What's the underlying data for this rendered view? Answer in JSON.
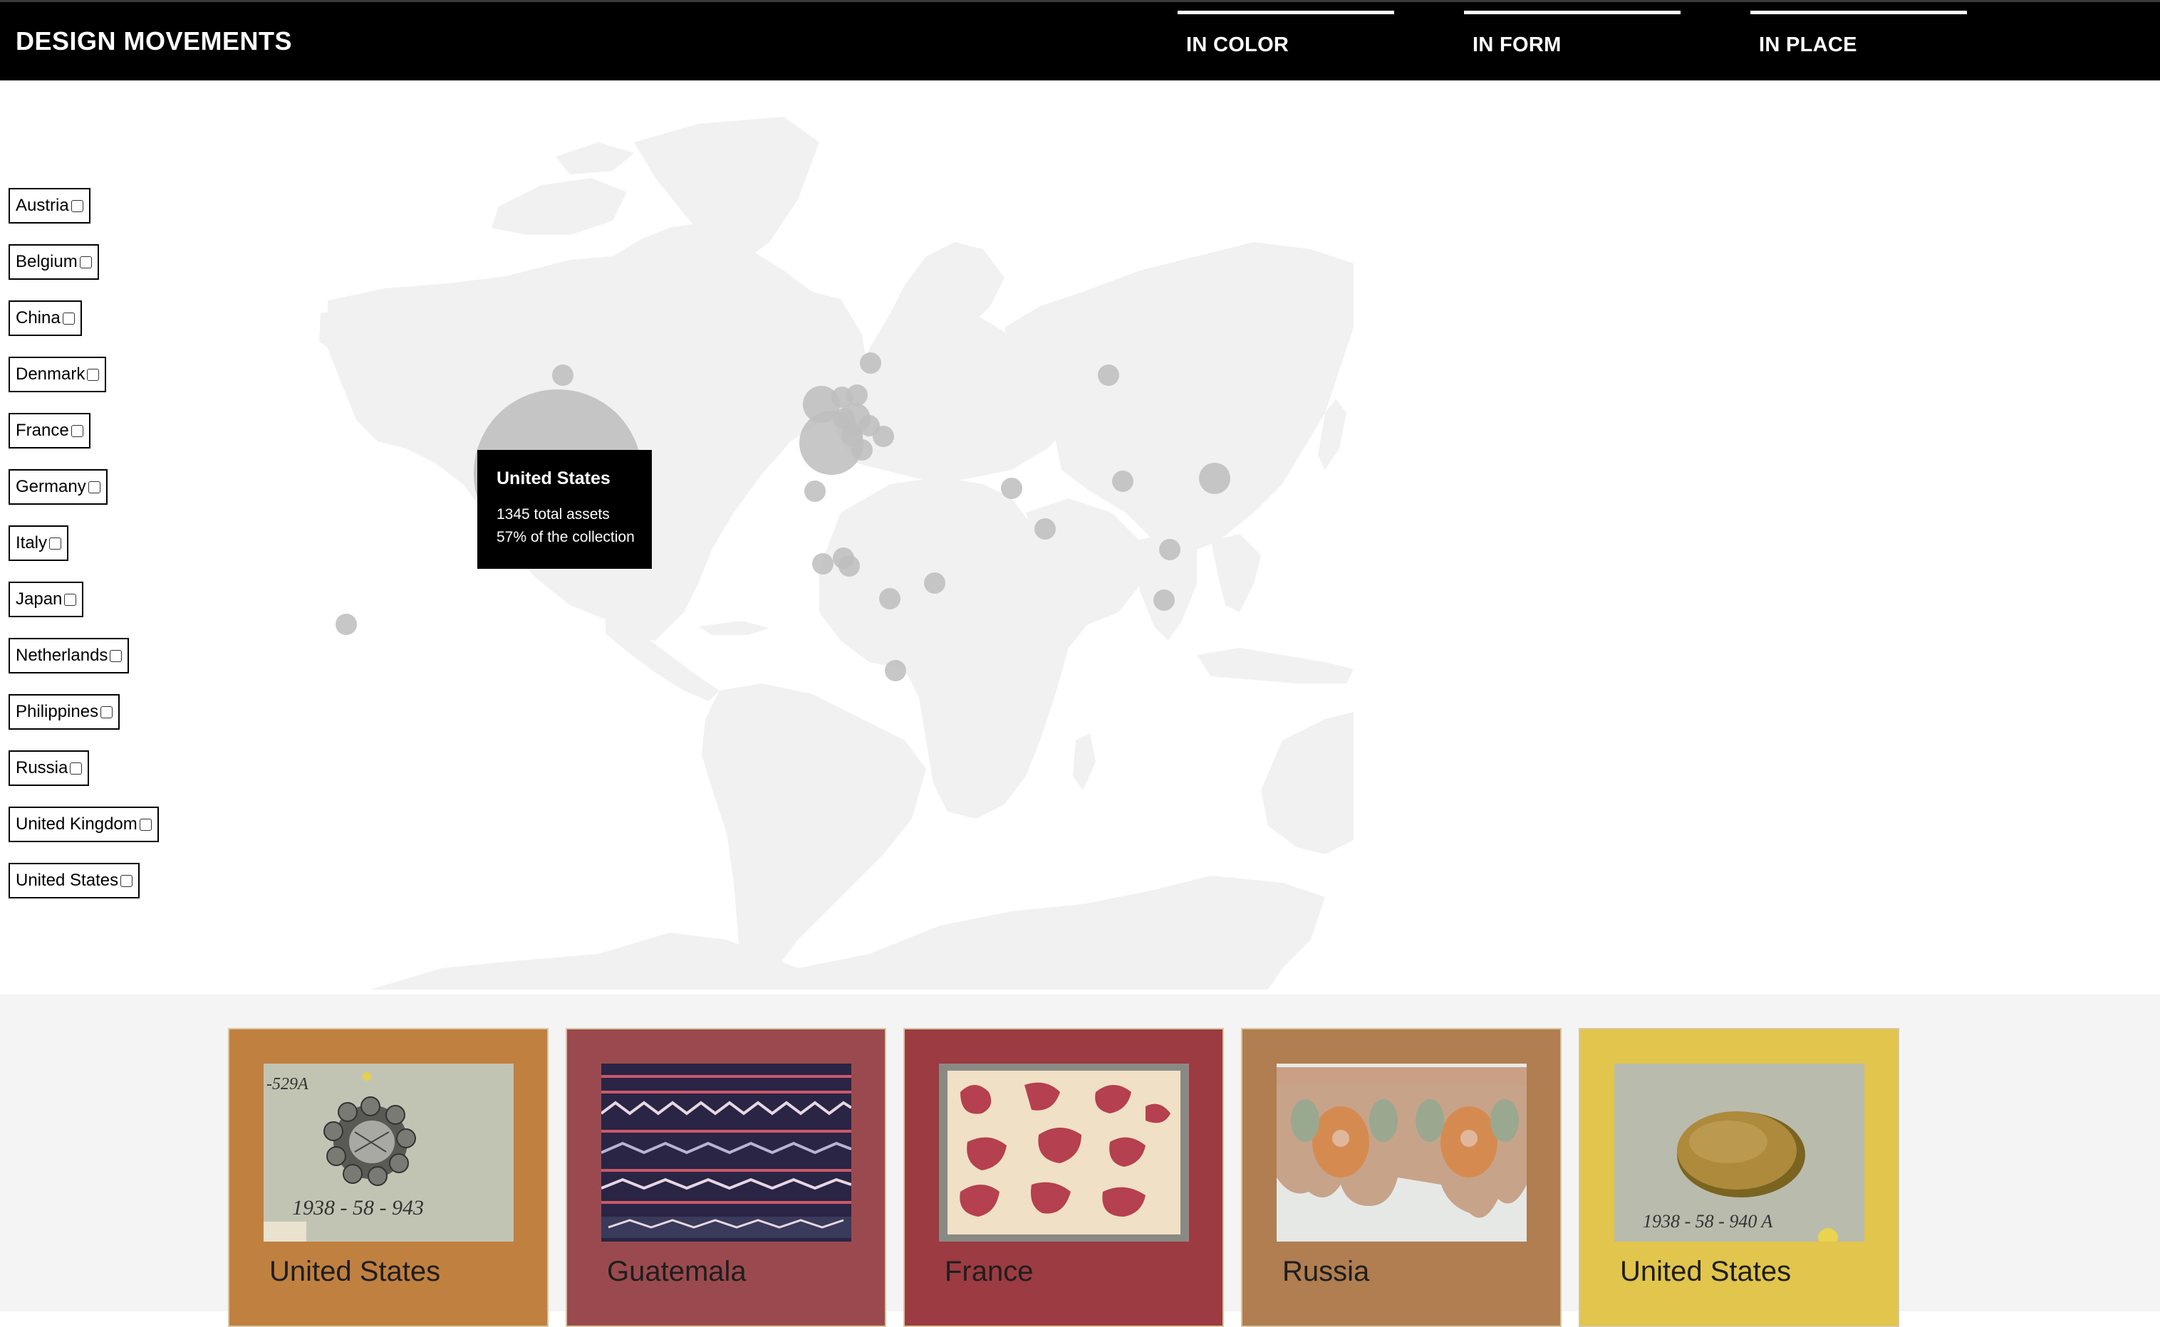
{
  "header": {
    "title": "DESIGN MOVEMENTS",
    "tabs": [
      {
        "label": "IN COLOR"
      },
      {
        "label": "IN FORM"
      },
      {
        "label": "IN PLACE"
      }
    ]
  },
  "filters": [
    {
      "label": "Austria",
      "checked": false
    },
    {
      "label": "Belgium",
      "checked": false
    },
    {
      "label": "China",
      "checked": false
    },
    {
      "label": "Denmark",
      "checked": false
    },
    {
      "label": "France",
      "checked": false
    },
    {
      "label": "Germany",
      "checked": false
    },
    {
      "label": "Italy",
      "checked": false
    },
    {
      "label": "Japan",
      "checked": false
    },
    {
      "label": "Netherlands",
      "checked": false
    },
    {
      "label": "Philippines",
      "checked": false
    },
    {
      "label": "Russia",
      "checked": false
    },
    {
      "label": "United Kingdom",
      "checked": false
    },
    {
      "label": "United States",
      "checked": false
    }
  ],
  "tooltip": {
    "title": "United States",
    "assets": "1345 total assets",
    "share": "57% of the collection"
  },
  "cards": [
    {
      "label": "United States",
      "color": "#c08040"
    },
    {
      "label": "Guatemala",
      "color": "#9a4a4e"
    },
    {
      "label": "France",
      "color": "#9c3b41"
    },
    {
      "label": "Russia",
      "color": "#b07e50"
    },
    {
      "label": "United States",
      "color": "#e1c54c"
    }
  ],
  "colors": {
    "header_bg": "#000000",
    "land": "#f1f1f1",
    "bubble": "#c4c4c4",
    "gallery_bg": "#f4f4f4"
  }
}
